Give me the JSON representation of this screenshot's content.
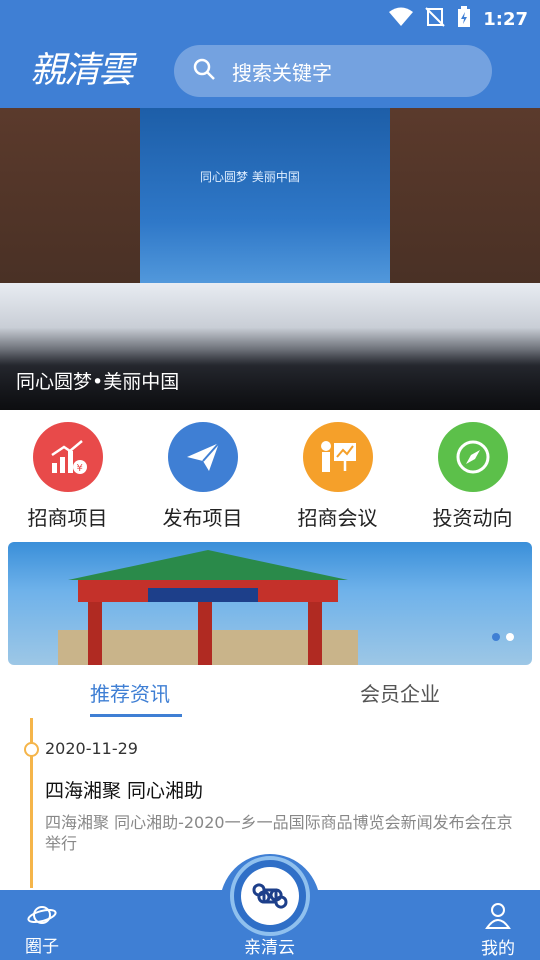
{
  "status_bar": {
    "time": "1:27"
  },
  "header": {
    "logo_text": "親清雲",
    "search_placeholder": "搜索关键字"
  },
  "hero": {
    "caption": "同心圆梦•美丽中国",
    "stage_text": "同心圆梦 美丽中国"
  },
  "actions": [
    {
      "label": "招商项目",
      "icon": "chart-money-icon",
      "color": "#e84a4a"
    },
    {
      "label": "发布项目",
      "icon": "paper-plane-icon",
      "color": "#3f7fd4"
    },
    {
      "label": "招商会议",
      "icon": "presentation-icon",
      "color": "#f5a02a"
    },
    {
      "label": "投资动向",
      "icon": "compass-icon",
      "color": "#5cc04a"
    }
  ],
  "tabs": {
    "recommended": "推荐资讯",
    "members": "会员企业"
  },
  "news": [
    {
      "date": "2020-11-29",
      "title": "四海湘聚 同心湘助",
      "summary": "四海湘聚 同心湘助-2020一乡一品国际商品博览会新闻发布会在京举行"
    }
  ],
  "bottom_nav": {
    "circle": "圈子",
    "center": "亲清云",
    "mine": "我的"
  },
  "colors": {
    "primary": "#3f7fd4",
    "timeline": "#f5b54a"
  }
}
